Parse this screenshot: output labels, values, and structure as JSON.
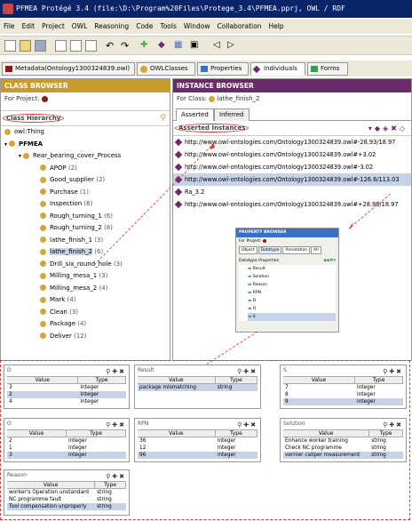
{
  "window_title": "PFMEA  Protégé 3.4    (file:\\D:\\Program%20Files\\Protege_3.4\\PFMEA.pprj, OWL / RDF",
  "menu": [
    "File",
    "Edit",
    "Project",
    "OWL",
    "Reasoning",
    "Code",
    "Tools",
    "Window",
    "Collaboration",
    "Help"
  ],
  "tabs": [
    "Metadata(Ontology1300324839.owl)",
    "OWLClasses",
    "Properties",
    "Individuals",
    "Forms"
  ],
  "class_browser": {
    "header": "CLASS BROWSER",
    "for_project": "For Project:",
    "hierarchy_label": "Class Hierarchy",
    "items": [
      {
        "label": "owl:Thing",
        "count": ""
      },
      {
        "label": "PFMEA",
        "count": ""
      },
      {
        "label": "Rear_bearing_cover_Process",
        "count": ""
      },
      {
        "label": "APOP",
        "count": "(2)"
      },
      {
        "label": "Good_supplier",
        "count": "(2)"
      },
      {
        "label": "Purchase",
        "count": "(1)"
      },
      {
        "label": "Inspection",
        "count": "(6)"
      },
      {
        "label": "Rough_turning_1",
        "count": "(6)"
      },
      {
        "label": "Rough_turning_2",
        "count": "(8)"
      },
      {
        "label": "lathe_finish_1",
        "count": "(3)"
      },
      {
        "label": "lathe_finish_2",
        "count": "(6)"
      },
      {
        "label": "Drill_six_round_hole",
        "count": "(3)"
      },
      {
        "label": "Milling_mesa_1",
        "count": "(3)"
      },
      {
        "label": "Milling_mesa_2",
        "count": "(4)"
      },
      {
        "label": "Mark",
        "count": "(4)"
      },
      {
        "label": "Clean",
        "count": "(3)"
      },
      {
        "label": "Package",
        "count": "(4)"
      },
      {
        "label": "Deliver",
        "count": "(12)"
      }
    ]
  },
  "instance_browser": {
    "header": "INSTANCE BROWSER",
    "for_class_label": "For Class:",
    "for_class": "lathe_finish_2",
    "tab_asserted": "Asserted",
    "tab_inferred": "Inferred",
    "asserted_label": "Asserted Instances",
    "instances": [
      "http://www.owl-ontologies.com/Ontology1300324839.owl#-28.93/18.97",
      "http://www.owl-ontologies.com/Ontology1300324839.owl#+3.02",
      "http://www.owl-ontologies.com/Ontology1300324839.owl#-3.02",
      "http://www.owl-ontologies.com/Ontology1300324839.owl#-126.6/113.03",
      "Ra_3.2",
      "http://www.owl-ontologies.com/Ontology1300324839.owl#+28.96/18.97"
    ]
  },
  "property_browser": {
    "header": "PROPERTY BROWSER",
    "for_project": "For Project:",
    "tabs": [
      "Object",
      "Datatype",
      "Annotation",
      "All"
    ],
    "list_header": "Datatype Properties",
    "items": [
      "Result",
      "Solution",
      "Reason",
      "RPN",
      "D",
      "O",
      "S"
    ]
  },
  "panels": [
    {
      "title": "D",
      "col1": "Value",
      "col2": "Type",
      "rows": [
        [
          "3",
          "integer"
        ],
        [
          "2",
          "integer"
        ],
        [
          "4",
          "integer"
        ]
      ]
    },
    {
      "title": "Result",
      "col1": "Value",
      "col2": "Type",
      "rows": [
        [
          "package mismatching",
          "string"
        ]
      ]
    },
    {
      "title": "S",
      "col1": "Value",
      "col2": "Type",
      "rows": [
        [
          "7",
          "integer"
        ],
        [
          "8",
          "integer"
        ],
        [
          "9",
          "integer"
        ]
      ]
    },
    {
      "title": "O",
      "col1": "Value",
      "col2": "Type",
      "rows": [
        [
          "2",
          "integer"
        ],
        [
          "1",
          "integer"
        ],
        [
          "3",
          "integer"
        ]
      ]
    },
    {
      "title": "RPN",
      "col1": "Value",
      "col2": "Type",
      "rows": [
        [
          "36",
          "integer"
        ],
        [
          "12",
          "integer"
        ],
        [
          "96",
          "integer"
        ]
      ]
    },
    {
      "title": "Solution",
      "col1": "Value",
      "col2": "Type",
      "rows": [
        [
          "Enhance worker training",
          "string"
        ],
        [
          "Check NC programme",
          "string"
        ],
        [
          "vernier caliper measurement",
          "string"
        ]
      ]
    },
    {
      "title": "Reason",
      "col1": "Value",
      "col2": "Type",
      "rows": [
        [
          "worker's Operation unstandard",
          "string"
        ],
        [
          "NC programme fault",
          "string"
        ],
        [
          "Tool compensation unproperly",
          "string"
        ]
      ]
    }
  ]
}
